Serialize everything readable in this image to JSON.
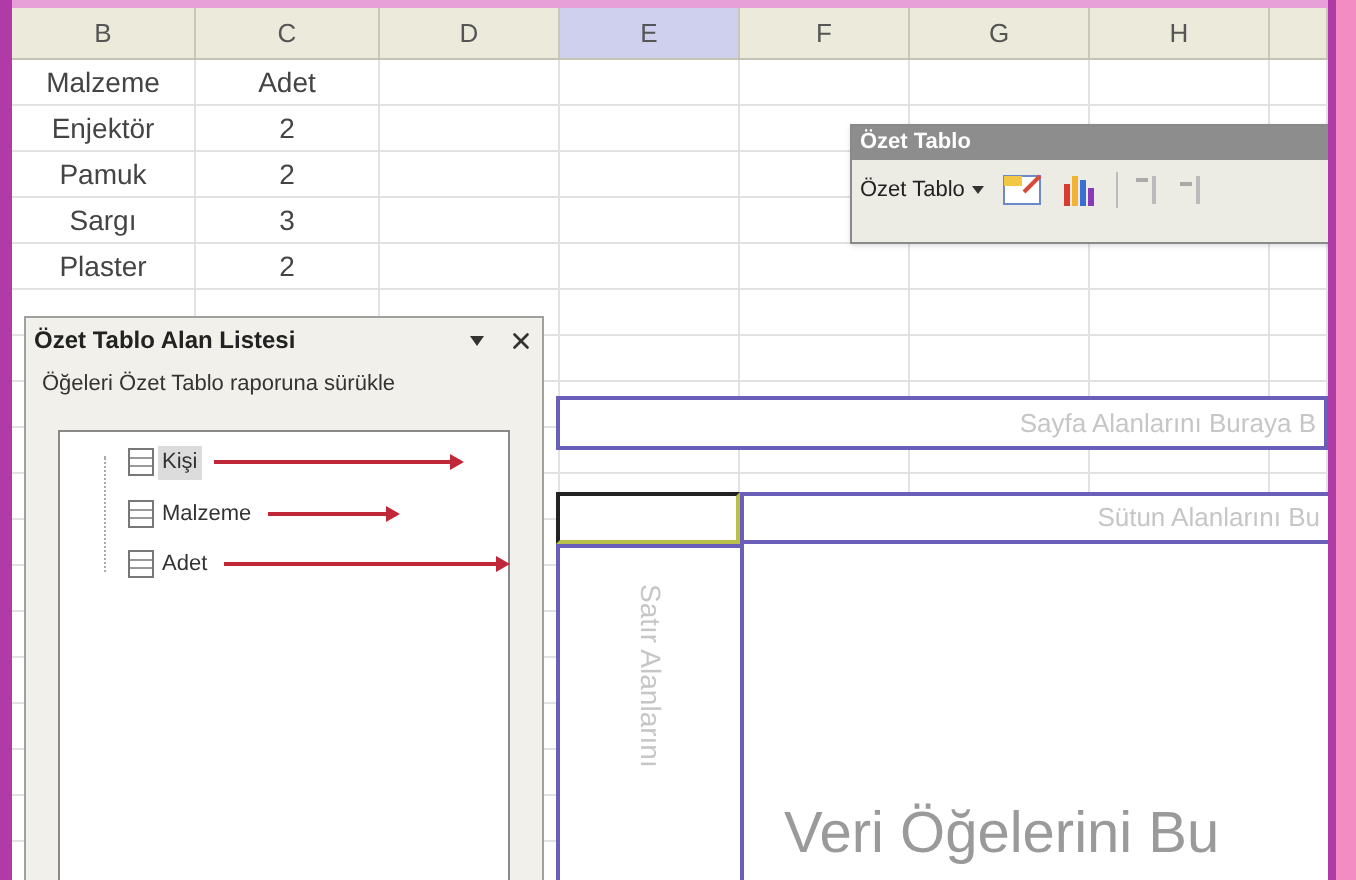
{
  "columns": [
    {
      "label": "B",
      "selected": false
    },
    {
      "label": "C",
      "selected": false
    },
    {
      "label": "D",
      "selected": false
    },
    {
      "label": "E",
      "selected": true
    },
    {
      "label": "F",
      "selected": false
    },
    {
      "label": "G",
      "selected": false
    },
    {
      "label": "H",
      "selected": false
    }
  ],
  "rows": [
    [
      "Malzeme",
      "Adet"
    ],
    [
      "Enjektör",
      "2"
    ],
    [
      "Pamuk",
      "2"
    ],
    [
      "Sargı",
      "3"
    ],
    [
      "Plaster",
      "2"
    ]
  ],
  "pivot_toolbar": {
    "title": "Özet Tablo",
    "menu": "Özet Tablo"
  },
  "field_list": {
    "title": "Özet Tablo Alan Listesi",
    "instruction": "Öğeleri Özet Tablo raporuna sürükle",
    "fields": [
      {
        "label": "Kişi",
        "selected": true
      },
      {
        "label": "Malzeme",
        "selected": false
      },
      {
        "label": "Adet",
        "selected": false
      }
    ]
  },
  "drop_areas": {
    "page": "Sayfa Alanlarını Buraya B",
    "column": "Sütun Alanlarını Bu",
    "row": "Satır Alanlarını",
    "data": "Veri Öğelerini Bu"
  }
}
